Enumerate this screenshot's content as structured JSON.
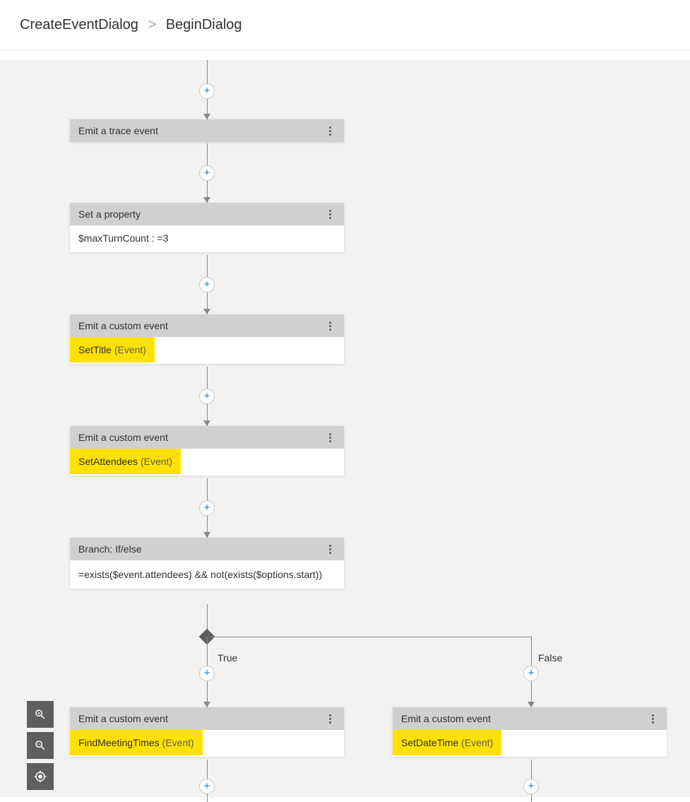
{
  "breadcrumb": {
    "parent": "CreateEventDialog",
    "current": "BeginDialog"
  },
  "branch": {
    "true_label": "True",
    "false_label": "False"
  },
  "nodes": {
    "n1": {
      "title": "Emit a trace event"
    },
    "n2": {
      "title": "Set a property",
      "body": "$maxTurnCount : =3"
    },
    "n3": {
      "title": "Emit a custom event",
      "event_name": "SetTitle",
      "event_suffix": "(Event)"
    },
    "n4": {
      "title": "Emit a custom event",
      "event_name": "SetAttendees",
      "event_suffix": "(Event)"
    },
    "n5": {
      "title": "Branch: If/else",
      "body": "=exists($event.attendees) && not(exists($options.start))"
    },
    "n6": {
      "title": "Emit a custom event",
      "event_name": "FindMeetingTimes",
      "event_suffix": "(Event)"
    },
    "n7": {
      "title": "Emit a custom event",
      "event_name": "SetDateTime",
      "event_suffix": "(Event)"
    }
  }
}
